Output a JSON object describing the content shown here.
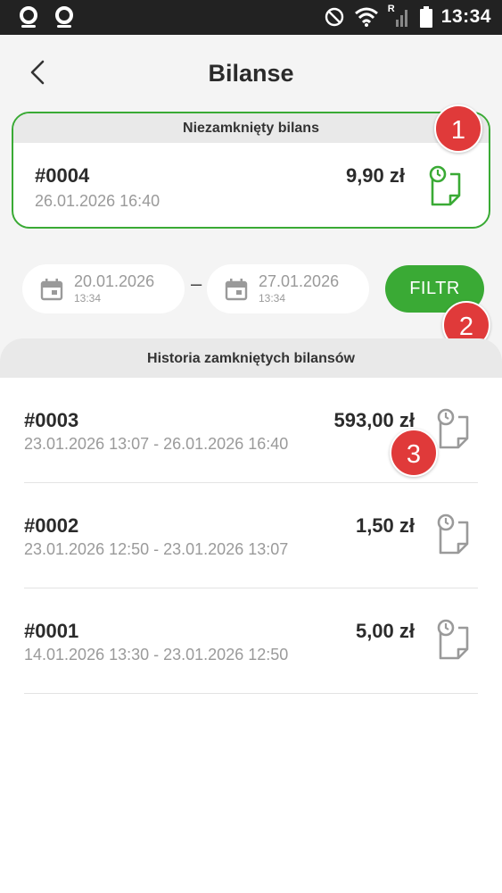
{
  "statusbar": {
    "time": "13:34",
    "roaming": "R"
  },
  "header": {
    "title": "Bilanse"
  },
  "open_balance": {
    "header": "Niezamknięty bilans",
    "number": "#0004",
    "date": "26.01.2026 16:40",
    "amount": "9,90 zł",
    "badge": "1"
  },
  "filter": {
    "from_date": "20.01.2026",
    "from_time": "13:34",
    "separator": "–",
    "to_date": "27.01.2026",
    "to_time": "13:34",
    "button_label": "FILTR",
    "badge": "2"
  },
  "history": {
    "header": "Historia zamkniętych bilansów",
    "badge": "3",
    "items": [
      {
        "number": "#0003",
        "range": "23.01.2026 13:07 - 26.01.2026 16:40",
        "amount": "593,00 zł"
      },
      {
        "number": "#0002",
        "range": "23.01.2026 12:50 - 23.01.2026 13:07",
        "amount": "1,50 zł"
      },
      {
        "number": "#0001",
        "range": "14.01.2026 13:30 - 23.01.2026 12:50",
        "amount": "5,00 zł"
      }
    ]
  },
  "colors": {
    "accent_green": "#3aaa35",
    "badge_red": "#e03a3a",
    "icon_gray": "#9a9a9a"
  }
}
